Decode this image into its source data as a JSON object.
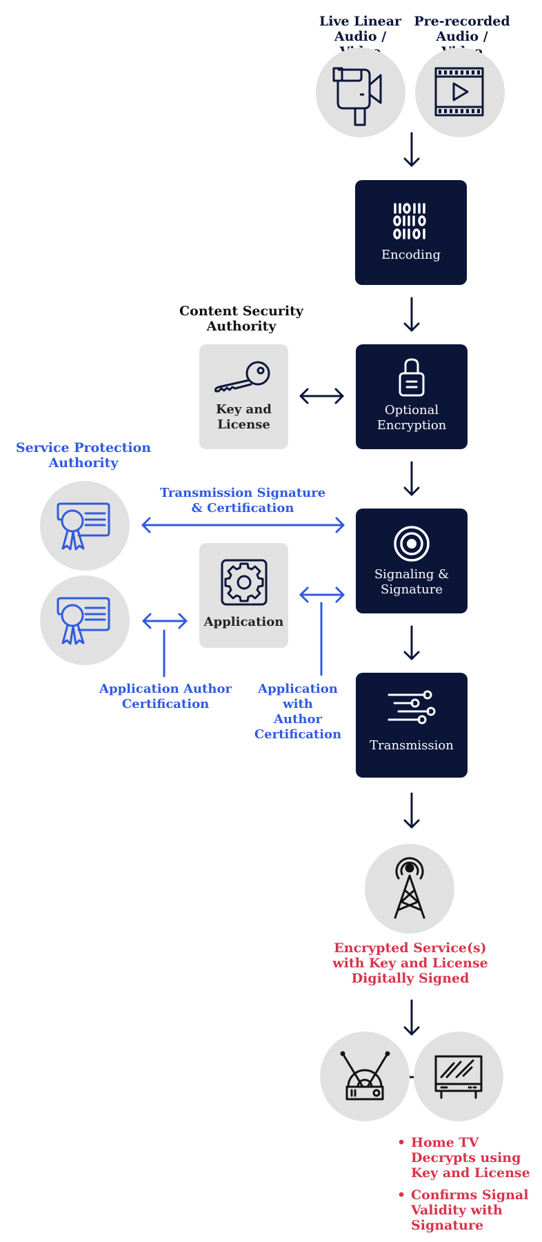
{
  "colors": {
    "navy": "#0b1538",
    "gray_fill": "#e1e1e1",
    "blue_accent": "#2f5ae0",
    "red_accent": "#d9334a",
    "white": "#ffffff"
  },
  "sources": [
    {
      "label": "Live Linear Audio / Video",
      "line1": "Live Linear",
      "line2": "Audio / Video",
      "icon": "video-camera-icon"
    },
    {
      "label": "Pre-recorded Audio / Video",
      "line1": "Pre-recorded",
      "line2": "Audio / Video",
      "icon": "film-play-icon"
    }
  ],
  "pipeline": [
    {
      "id": "encoding",
      "line1": "Encoding",
      "line2": "",
      "icon": "binary-code-icon"
    },
    {
      "id": "encryption",
      "line1": "Optional",
      "line2": "Encryption",
      "icon": "padlock-icon"
    },
    {
      "id": "signaling",
      "line1": "Signaling &",
      "line2": "Signature",
      "icon": "target-icon"
    },
    {
      "id": "transmission",
      "line1": "Transmission",
      "line2": "",
      "icon": "signal-lines-icon"
    }
  ],
  "content_security_authority": {
    "title_line1": "Content Security",
    "title_line2": "Authority",
    "box_line1": "Key and",
    "box_line2": "License",
    "icon": "key-icon"
  },
  "service_protection_authority": {
    "title_line1": "Service Protection",
    "title_line2": "Authority",
    "icon": "certificate-icon"
  },
  "application": {
    "label": "Application",
    "icon": "gear-icon"
  },
  "connectors": {
    "transmission_signature_line1": "Transmission Signature",
    "transmission_signature_line2": "& Certification",
    "app_author_cert_line1": "Application Author",
    "app_author_cert_line2": "Certification",
    "app_with_author_line1": "Application",
    "app_with_author_line2": "with",
    "app_with_author_line3": "Author",
    "app_with_author_line4": "Certification"
  },
  "broadcast": {
    "icon": "broadcast-tower-icon",
    "line1": "Encrypted Service(s)",
    "line2": "with Key and License",
    "line3": "Digitally Signed"
  },
  "receivers": [
    {
      "icon": "antenna-receiver-icon"
    },
    {
      "icon": "television-icon"
    }
  ],
  "outcomes": [
    {
      "line1": "Home TV",
      "line2": "Decrypts using",
      "line3": "Key and License"
    },
    {
      "line1": "Confirms Signal",
      "line2": "Validity with",
      "line3": "Signature"
    }
  ],
  "bullet_glyph": "•"
}
